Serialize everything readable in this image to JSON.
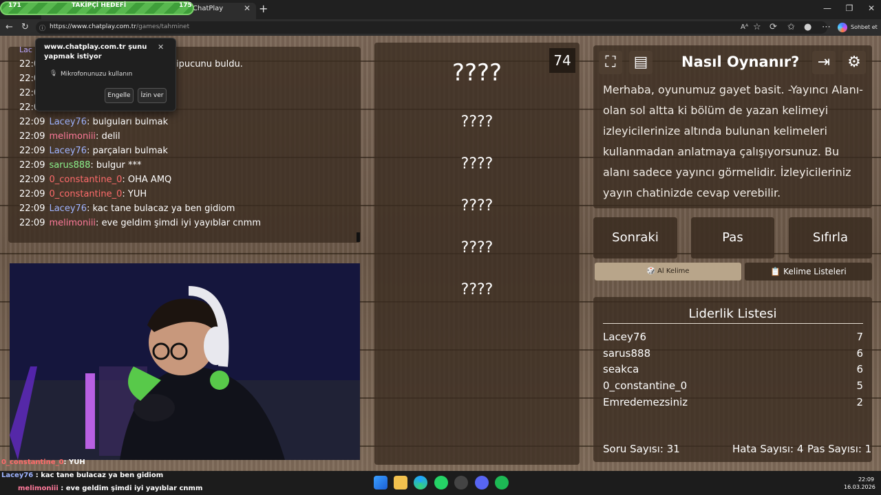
{
  "browser": {
    "tab_title": "ChatPlay",
    "url_host": "https://www.chatplay.com.tr",
    "url_path": "/games/tahminet",
    "profile_button": "Sohbet et"
  },
  "goal": {
    "start": "171",
    "label": "TAKİPÇİ HEDEFİ",
    "end": "175"
  },
  "permission": {
    "title": "www.chatplay.com.tr şunu yapmak istiyor",
    "item": "Mikrofonunuzu kullanın",
    "block": "Engelle",
    "allow": "İzin ver"
  },
  "chat": {
    "partial_name": "Lac",
    "partial_msg": "ipucunu buldu.",
    "lines": [
      {
        "time": "22:09",
        "user": "Lacey76",
        "msg": "bulguları bulmak"
      },
      {
        "time": "22:09",
        "user": "melimoniii",
        "msg": "delil"
      },
      {
        "time": "22:09",
        "user": "Lacey76",
        "msg": "parçaları bulmak"
      },
      {
        "time": "22:09",
        "user": "sarus888",
        "msg": "bulgur ***"
      },
      {
        "time": "22:09",
        "user": "0_constantine_0",
        "msg": "OHA AMQ"
      },
      {
        "time": "22:09",
        "user": "0_constantine_0",
        "msg": "YUH"
      },
      {
        "time": "22:09",
        "user": "Lacey76",
        "msg": "kac tane bulacaz ya ben gidiom"
      },
      {
        "time": "22:09",
        "user": "melimoniii",
        "msg": "eve geldim şimdi iyi yayıblar cnmm"
      }
    ],
    "hidden_times": [
      "22:0",
      "22:0",
      "22:0",
      "22:0"
    ]
  },
  "game": {
    "timer": "74",
    "words": [
      "????",
      "????",
      "????",
      "????",
      "????",
      "????"
    ]
  },
  "info": {
    "title": "Nasıl Oynanır?",
    "text": "Merhaba, oyunumuz gayet basit. -Yayıncı Alanı- olan sol altta ki bölüm de yazan kelimeyi izleyicilerinize altında bulunan kelimeleri kullanmadan anlatmaya çalışıyorsunuz. Bu alanı sadece yayıncı görmelidir. İzleyicileriniz yayın chatinizde cevap verebilir."
  },
  "buttons": {
    "next": "Sonraki",
    "pass": "Pas",
    "reset": "Sıfırla"
  },
  "tabs": {
    "word": "🎲 Al Kelime",
    "lists": "📋 Kelime Listeleri"
  },
  "leaderboard": {
    "title": "Liderlik Listesi",
    "rows": [
      {
        "name": "Lacey76",
        "score": "7"
      },
      {
        "name": "sarus888",
        "score": "6"
      },
      {
        "name": "seakca",
        "score": "6"
      },
      {
        "name": "0_constantine_0",
        "score": "5"
      },
      {
        "name": "Emredemezsiniz",
        "score": "2"
      }
    ]
  },
  "stats": {
    "questions": "Soru Sayısı: 31",
    "errors": "Hata Sayısı: 4",
    "passes": "Pas Sayısı: 1"
  },
  "ticker": [
    {
      "user": "0_constantine_0",
      "msg": ": YUH"
    },
    {
      "user": "Lacey76",
      "msg": " : kac tane bulacaz ya ben gidiom"
    },
    {
      "user": "melimoniii",
      "msg": " : eve geldim şimdi iyi yayıblar cnmm"
    }
  ],
  "clock": {
    "time": "22:09",
    "date": "16.03.2026"
  },
  "colors": {
    "accent_green": "#58b84f",
    "wood": "#6b5848",
    "tab_active": "#b8a58a"
  }
}
